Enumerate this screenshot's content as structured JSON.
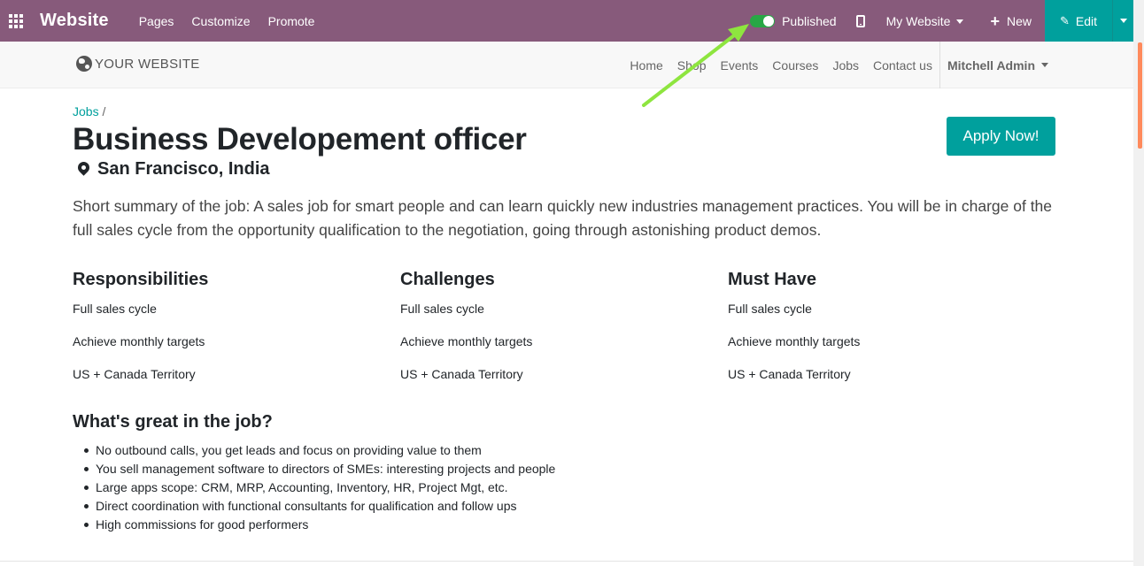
{
  "topbar": {
    "brand": "Website",
    "menu": [
      "Pages",
      "Customize",
      "Promote"
    ],
    "published_label": "Published",
    "published": true,
    "my_website_label": "My Website",
    "new_label": "New",
    "edit_label": "Edit",
    "color": "#875a7b",
    "accent": "#00a09d"
  },
  "site": {
    "logo_text": "YOUR WEBSITE",
    "nav": [
      "Home",
      "Shop",
      "Events",
      "Courses",
      "Jobs",
      "Contact us"
    ],
    "user": "Mitchell Admin"
  },
  "job": {
    "breadcrumb_link": "Jobs",
    "breadcrumb_sep": "/",
    "title": "Business Developement officer",
    "location": "San Francisco, India",
    "apply_label": "Apply Now!",
    "summary": "Short summary of the job: A sales job for smart people and can learn quickly new industries management practices. You will be in charge of the full sales cycle from the opportunity qualification to the negotiation, going through astonishing product demos.",
    "columns": [
      {
        "heading": "Responsibilities",
        "items": [
          "Full sales cycle",
          "Achieve monthly targets",
          "US + Canada Territory"
        ]
      },
      {
        "heading": "Challenges",
        "items": [
          "Full sales cycle",
          "Achieve monthly targets",
          "US + Canada Territory"
        ]
      },
      {
        "heading": "Must Have",
        "items": [
          "Full sales cycle",
          "Achieve monthly targets",
          "US + Canada Territory"
        ]
      }
    ],
    "great_heading": "What's great in the job?",
    "great_items": [
      "No outbound calls, you get leads and focus on providing value to them",
      "You sell management software to directors of SMEs: interesting projects and people",
      "Large apps scope: CRM, MRP, Accounting, Inventory, HR, Project Mgt, etc.",
      "Direct coordination with functional consultants for qualification and follow ups",
      "High commissions for good performers"
    ]
  },
  "icons": {
    "apps": "apps-grid-icon",
    "mobile": "mobile-icon",
    "plus": "plus-icon",
    "pencil": "pencil-icon",
    "globe": "globe-icon",
    "pin": "map-marker-icon"
  },
  "annotation_arrow_color": "#8ee53f"
}
